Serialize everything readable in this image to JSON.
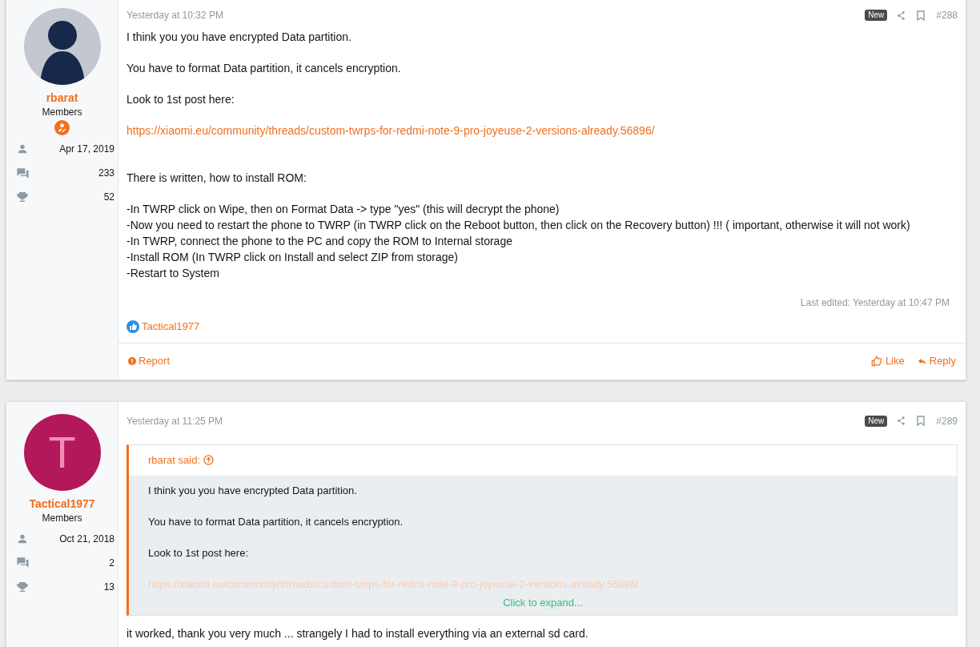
{
  "posts": [
    {
      "user": {
        "name": "rbarat",
        "role": "Members",
        "avatar": {
          "kind": "silhouette"
        },
        "badge": true,
        "joined": "Apr 17, 2019",
        "messages": "233",
        "points": "52"
      },
      "date": "Yesterday at 10:32 PM",
      "new_label": "New",
      "number": "#288",
      "blocks": [
        {
          "kind": "text",
          "lines": [
            "I think you you have encrypted Data partition."
          ]
        },
        {
          "kind": "text",
          "lines": [
            "You have to format Data partition, it cancels encryption."
          ]
        },
        {
          "kind": "text",
          "lines": [
            "Look to 1st post here:"
          ]
        },
        {
          "kind": "link",
          "lines": [
            "https://xiaomi.eu/community/threads/custom-twrps-for-redmi-note-9-pro-joyeuse-2-versions-already.56896/"
          ]
        },
        {
          "kind": "text",
          "lines": [
            "There is written, how to install ROM:"
          ]
        },
        {
          "kind": "text",
          "lines": [
            "-In TWRP click on Wipe, then on Format Data -> type \"yes\" (this will decrypt the phone)",
            "-Now you need to restart the phone to TWRP (in TWRP click on the Reboot button, then click on the Recovery button) !!! ( important, otherwise it will not work)",
            "-In TWRP, connect the phone to the PC and copy the ROM to Internal storage",
            "-Install ROM (In TWRP click on Install and select ZIP from storage)",
            "-Restart to System"
          ]
        }
      ],
      "edited": "Last edited: Yesterday at 10:47 PM",
      "reaction": "Tactical1977",
      "actions": {
        "report": "Report",
        "like": "Like",
        "reply": "Reply"
      }
    },
    {
      "user": {
        "name": "Tactical1977",
        "role": "Members",
        "avatar": {
          "kind": "letter",
          "letter": "T"
        },
        "badge": false,
        "joined": "Oct 21, 2018",
        "messages": "2",
        "points": "13"
      },
      "date": "Yesterday at 11:25 PM",
      "new_label": "New",
      "number": "#289",
      "quote": {
        "author": "rbarat said:",
        "blocks": [
          {
            "kind": "text",
            "lines": [
              "I think you you have encrypted Data partition."
            ]
          },
          {
            "kind": "text",
            "lines": [
              "You have to format Data partition, it cancels encryption."
            ]
          },
          {
            "kind": "text",
            "lines": [
              "Look to 1st post here:"
            ]
          },
          {
            "kind": "link",
            "lines": [
              "https://xiaomi.eu/community/threads/custom-twrps-for-redmi-note-9-pro-joyeuse-2-versions-already.56896/"
            ]
          }
        ],
        "expand": "Click to expand..."
      },
      "blocks": [
        {
          "kind": "text",
          "lines": [
            "it worked, thank you very much ... strangely I had to install everything via an external sd card."
          ]
        }
      ]
    }
  ]
}
